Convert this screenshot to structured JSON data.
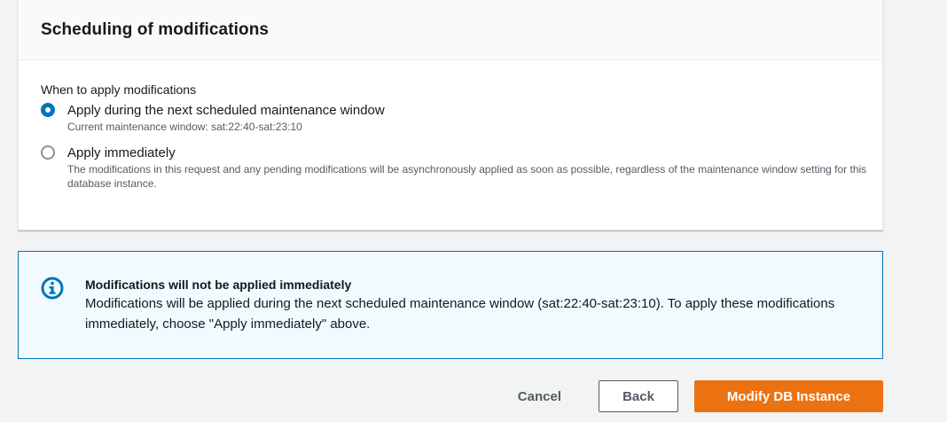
{
  "panel": {
    "title": "Scheduling of modifications",
    "field_label": "When to apply modifications",
    "options": [
      {
        "label": "Apply during the next scheduled maintenance window",
        "description": "Current maintenance window: sat:22:40-sat:23:10",
        "selected": true
      },
      {
        "label": "Apply immediately",
        "description": "The modifications in this request and any pending modifications will be asynchronously applied as soon as possible, regardless of the maintenance window setting for this database instance.",
        "selected": false
      }
    ]
  },
  "alert": {
    "icon": "info-icon",
    "title": "Modifications will not be applied immediately",
    "text": "Modifications will be applied during the next scheduled maintenance window (sat:22:40-sat:23:10). To apply these modifications immediately, choose \"Apply immediately\" above."
  },
  "actions": {
    "cancel_label": "Cancel",
    "back_label": "Back",
    "submit_label": "Modify DB Instance"
  },
  "colors": {
    "accent": "#0073bb",
    "primary_button": "#ec7211",
    "alert_background": "#f1faff",
    "page_background": "#f2f3f3"
  }
}
